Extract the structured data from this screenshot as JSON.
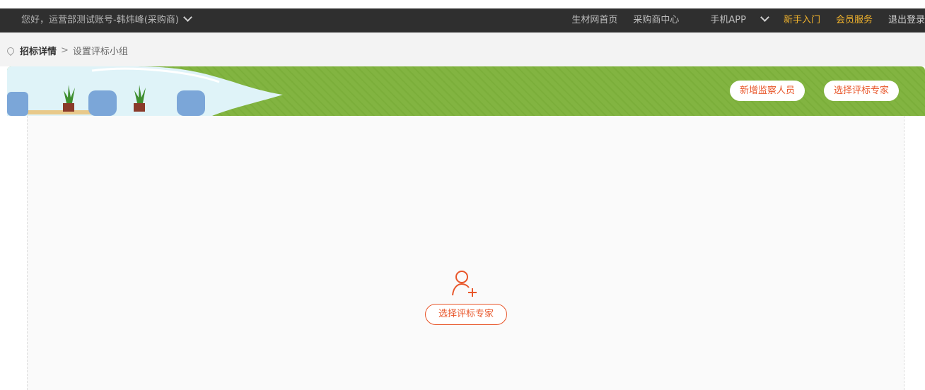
{
  "topbar": {
    "greeting": "您好，运营部测试账号-韩炜峰(采购商)",
    "nav": [
      {
        "label": "生材网首页"
      },
      {
        "label": "采购商中心"
      },
      {
        "label": "手机APP"
      },
      {
        "label": "新手入门"
      },
      {
        "label": "会员服务"
      },
      {
        "label": "退出登录"
      }
    ]
  },
  "breadcrumb": {
    "link": "招标详情",
    "separator": ">",
    "current": "设置评标小组"
  },
  "banner": {
    "add_supervisor_label": "新增监察人员",
    "select_expert_label": "选择评标专家"
  },
  "main": {
    "select_expert_label": "选择评标专家"
  },
  "colors": {
    "accent": "#e8562a",
    "banner_green": "#82b441",
    "topbar_bg": "#2f2f2f",
    "gold": "#f4b52c"
  }
}
